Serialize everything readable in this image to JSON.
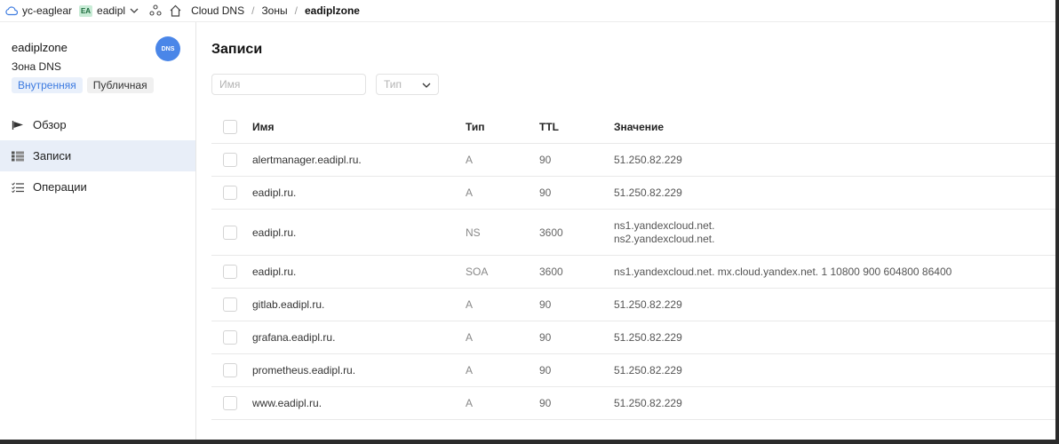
{
  "topbar": {
    "cloud_icon": "cloud-icon",
    "cloud_name": "yc-eaglear",
    "folder_badge": "EA",
    "folder_name": "eadipl",
    "service_icon": "services-icon",
    "home_icon": "home-icon",
    "crumbs": [
      "Cloud DNS",
      "Зоны"
    ],
    "separator": "/",
    "current": "eadiplzone"
  },
  "sidebar": {
    "zone_name": "eadiplzone",
    "zone_subtitle": "Зона DNS",
    "avatar_label": "DNS",
    "avatar_color": "#4a86e8",
    "chips": [
      {
        "label": "Внутренняя",
        "active": true
      },
      {
        "label": "Публичная",
        "active": false
      }
    ],
    "nav": [
      {
        "label": "Обзор",
        "icon": "flag-icon"
      },
      {
        "label": "Записи",
        "icon": "list-icon",
        "active": true
      },
      {
        "label": "Операции",
        "icon": "checklist-icon"
      }
    ]
  },
  "main": {
    "title": "Записи",
    "filter_name_placeholder": "Имя",
    "filter_type_placeholder": "Тип",
    "columns": [
      "Имя",
      "Тип",
      "TTL",
      "Значение"
    ],
    "records": [
      {
        "name": "alertmanager.eadipl.ru.",
        "type": "A",
        "ttl": "90",
        "value": [
          "51.250.82.229"
        ]
      },
      {
        "name": "eadipl.ru.",
        "type": "A",
        "ttl": "90",
        "value": [
          "51.250.82.229"
        ]
      },
      {
        "name": "eadipl.ru.",
        "type": "NS",
        "ttl": "3600",
        "value": [
          "ns1.yandexcloud.net.",
          "ns2.yandexcloud.net."
        ]
      },
      {
        "name": "eadipl.ru.",
        "type": "SOA",
        "ttl": "3600",
        "value": [
          "ns1.yandexcloud.net. mx.cloud.yandex.net. 1 10800 900 604800 86400"
        ]
      },
      {
        "name": "gitlab.eadipl.ru.",
        "type": "A",
        "ttl": "90",
        "value": [
          "51.250.82.229"
        ]
      },
      {
        "name": "grafana.eadipl.ru.",
        "type": "A",
        "ttl": "90",
        "value": [
          "51.250.82.229"
        ]
      },
      {
        "name": "prometheus.eadipl.ru.",
        "type": "A",
        "ttl": "90",
        "value": [
          "51.250.82.229"
        ]
      },
      {
        "name": "www.eadipl.ru.",
        "type": "A",
        "ttl": "90",
        "value": [
          "51.250.82.229"
        ]
      }
    ]
  },
  "colors": {
    "accent": "#3d7be0",
    "nav_active_bg": "#e8eef8",
    "badge_bg": "#c8ecd6"
  }
}
